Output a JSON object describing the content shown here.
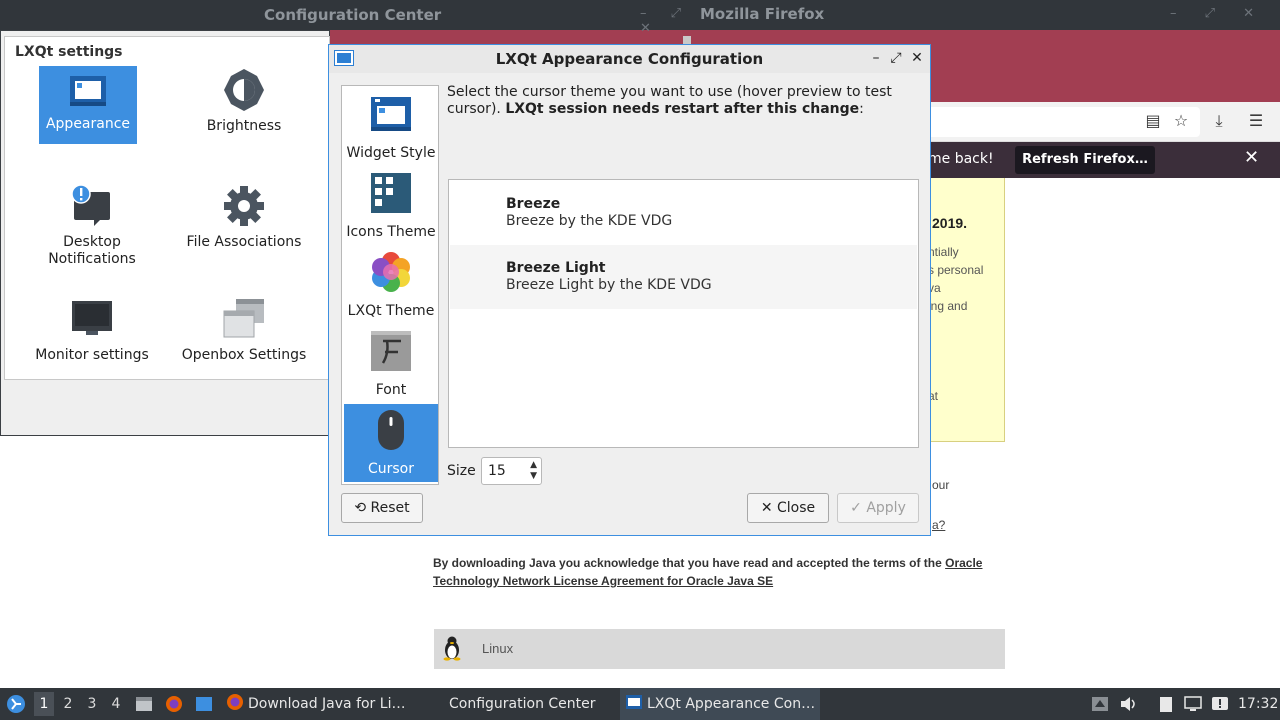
{
  "firefox": {
    "title": "Mozilla Firefox",
    "notification": {
      "message": "me back!",
      "refresh_label": "Refresh Firefox…",
      "close_glyph": "✕"
    },
    "page": {
      "yellow_heading": "2019.",
      "yellow_lines": [
        "ntially",
        "s personal",
        "va",
        "ing and",
        "at"
      ],
      "frag_your": "our",
      "frag_a": "a?",
      "terms_text": "By downloading Java you acknowledge that you have read and accepted the terms of the ",
      "terms_link": "Oracle Technology Network License Agreement for Oracle Java SE",
      "linux_label": "Linux"
    }
  },
  "config_center": {
    "title": "Configuration Center",
    "heading": "LXQt settings",
    "items": [
      {
        "label": "Appearance",
        "icon": "appearance-icon"
      },
      {
        "label": "Brightness",
        "icon": "brightness-icon"
      },
      {
        "label": "Desktop\nNotifications",
        "icon": "notifications-icon"
      },
      {
        "label": "File Associations",
        "icon": "gear-icon"
      },
      {
        "label": "Monitor settings",
        "icon": "monitor-icon"
      },
      {
        "label": "Openbox Settings",
        "icon": "openbox-icon"
      }
    ]
  },
  "dialog": {
    "title": "LXQt Appearance Configuration",
    "sidebar": [
      "Widget Style",
      "Icons Theme",
      "LXQt Theme",
      "Font",
      "Cursor"
    ],
    "description_plain": "Select the cursor theme you want to use (hover preview to test cursor). ",
    "description_bold": "LXQt session needs restart after this change",
    "description_end": ":",
    "themes": [
      {
        "name": "Breeze",
        "description": "Breeze by the KDE VDG"
      },
      {
        "name": "Breeze Light",
        "description": "Breeze Light by the KDE VDG"
      }
    ],
    "size_label": "Size",
    "size_value": "15",
    "reset_label": "Reset",
    "close_label": "Close",
    "apply_label": "Apply"
  },
  "taskbar": {
    "desktops": [
      "1",
      "2",
      "3",
      "4"
    ],
    "tasks": [
      "Download Java for Li…",
      "Configuration Center",
      "LXQt Appearance Con…"
    ],
    "clock": "17:32"
  },
  "colors": {
    "accent": "#3d8fe0",
    "titlebar": "#31363b",
    "firefox_tabs": "#a23e52"
  }
}
